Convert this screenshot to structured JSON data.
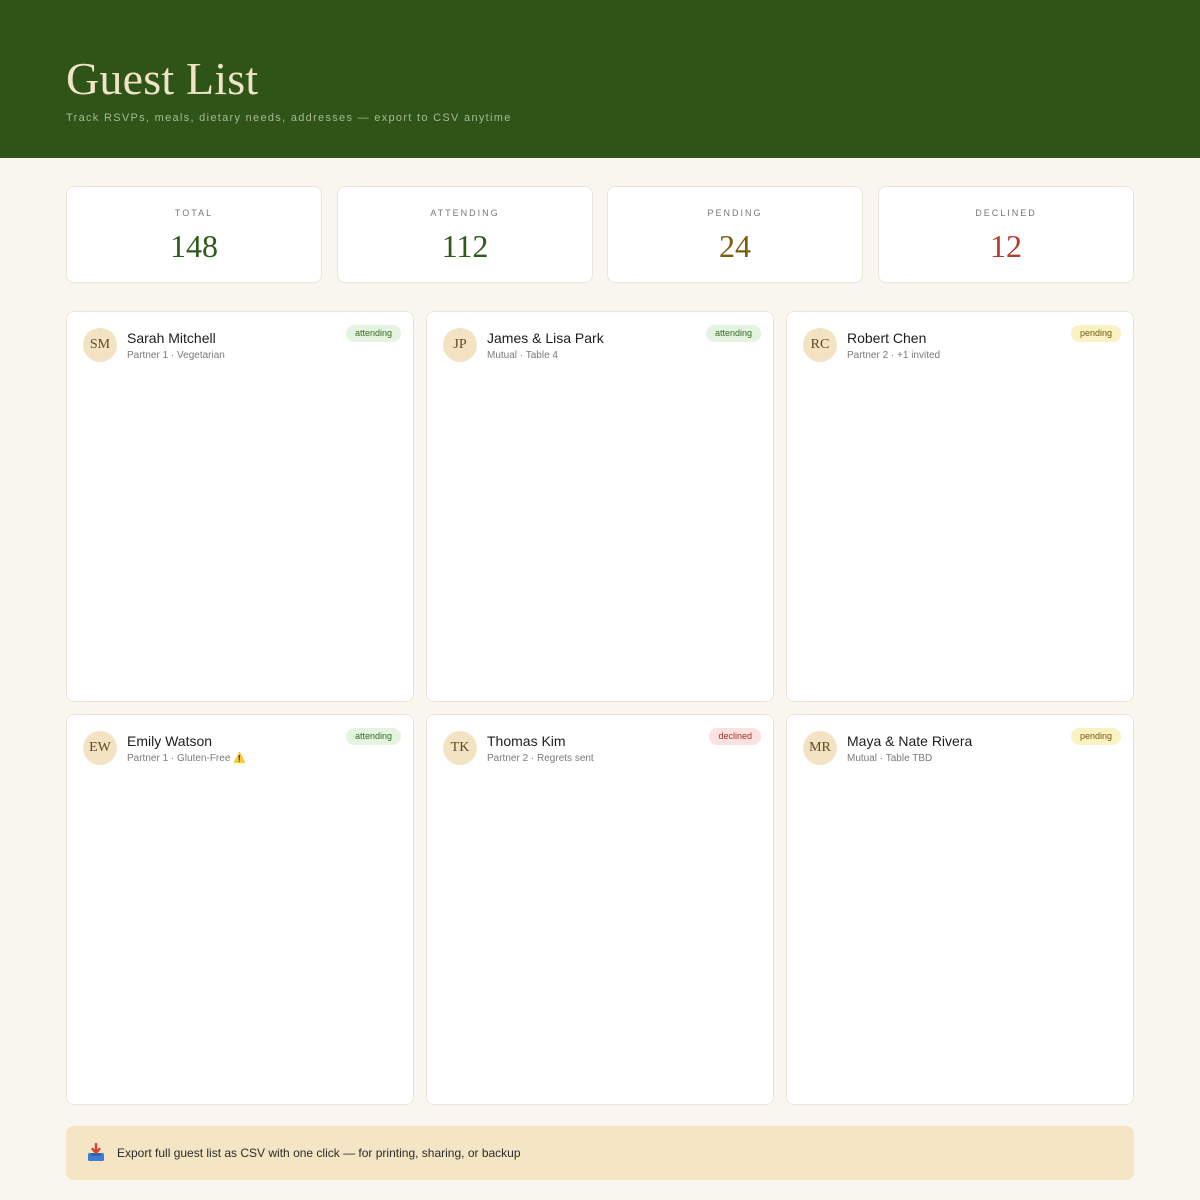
{
  "header": {
    "title": "Guest List",
    "subtitle": "Track RSVPs, meals, dietary needs, addresses — export to CSV anytime"
  },
  "stats": [
    {
      "label": "TOTAL",
      "value": "148",
      "color": "#2f5a1b"
    },
    {
      "label": "ATTENDING",
      "value": "112",
      "color": "#2f5a1b"
    },
    {
      "label": "PENDING",
      "value": "24",
      "color": "#7a5d0c"
    },
    {
      "label": "DECLINED",
      "value": "12",
      "color": "#b43b2f"
    }
  ],
  "guests": [
    {
      "initials": "SM",
      "name": "Sarah Mitchell",
      "meta": "Partner 1 · Vegetarian",
      "status": "attending"
    },
    {
      "initials": "JP",
      "name": "James & Lisa Park",
      "meta": "Mutual · Table 4",
      "status": "attending"
    },
    {
      "initials": "RC",
      "name": "Robert Chen",
      "meta": "Partner 2 · +1 invited",
      "status": "pending"
    },
    {
      "initials": "EW",
      "name": "Emily Watson",
      "meta": "Partner 1 · Gluten-Free",
      "flag": "⚠️",
      "status": "attending"
    },
    {
      "initials": "TK",
      "name": "Thomas Kim",
      "meta": "Partner 2 · Regrets sent",
      "status": "declined"
    },
    {
      "initials": "MR",
      "name": "Maya & Nate Rivera",
      "meta": "Mutual · Table TBD",
      "status": "pending"
    }
  ],
  "export": {
    "icon": "inbox-tray-icon",
    "text": "Export full guest list as CSV with one click — for printing, sharing, or backup"
  },
  "colors": {
    "header_bg": "#2e5418",
    "page_bg": "#f9f6f0",
    "title": "#f1e4c6",
    "avatar_bg": "#f3e3c3",
    "export_bg": "#f4e5c4"
  }
}
